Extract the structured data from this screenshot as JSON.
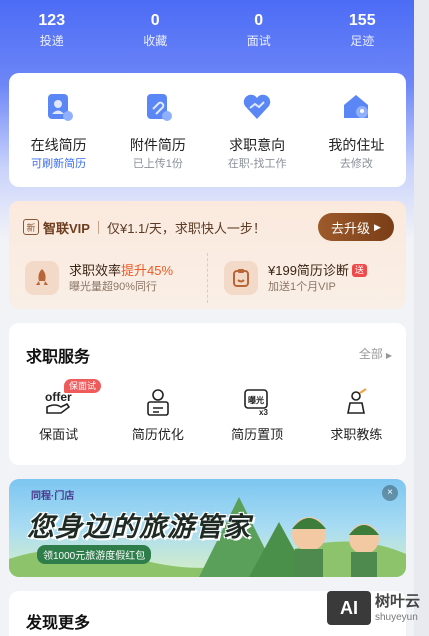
{
  "stats": [
    {
      "value": "123",
      "label": "投递"
    },
    {
      "value": "0",
      "label": "收藏"
    },
    {
      "value": "0",
      "label": "面试"
    },
    {
      "value": "155",
      "label": "足迹"
    }
  ],
  "resume": [
    {
      "title": "在线简历",
      "subtitle": "可刷新简历",
      "icon": "online-resume-icon"
    },
    {
      "title": "附件简历",
      "subtitle": "已上传1份",
      "icon": "attachment-resume-icon"
    },
    {
      "title": "求职意向",
      "subtitle": "在职-找工作",
      "icon": "job-intention-icon"
    },
    {
      "title": "我的住址",
      "subtitle": "去修改",
      "icon": "address-icon"
    }
  ],
  "vip": {
    "badge": "新",
    "brand": "智联VIP",
    "desc": "仅¥1.1/天，求职快人一步！",
    "button": "去升级",
    "left_title_prefix": "求职效率",
    "left_title_highlight": "提升45%",
    "left_sub": "曝光量超90%同行",
    "right_title": "¥199简历诊断",
    "right_tag": "送",
    "right_sub": "加送1个月VIP"
  },
  "services": {
    "title": "求职服务",
    "more": "全部",
    "items": [
      {
        "label": "保面试",
        "badge": "保面试",
        "icon_text": "offer"
      },
      {
        "label": "简历优化",
        "icon": "resume-optimize-icon"
      },
      {
        "label": "简历置顶",
        "icon_text": "曝光",
        "icon_sub": "x3"
      },
      {
        "label": "求职教练",
        "icon": "coach-icon"
      }
    ]
  },
  "banner": {
    "tag": "同程·门店",
    "title": "您身边的旅游管家",
    "pill": "领1000元旅游度假红包",
    "close": "×"
  },
  "discover": {
    "title": "发现更多"
  },
  "watermark": {
    "box": "AI",
    "title": "树叶云",
    "subtitle": "shuyeyun"
  },
  "colors": {
    "brand_blue": "#4c6cf5",
    "vip_brown": "#7a3e17",
    "highlight_orange": "#ef5a26"
  }
}
